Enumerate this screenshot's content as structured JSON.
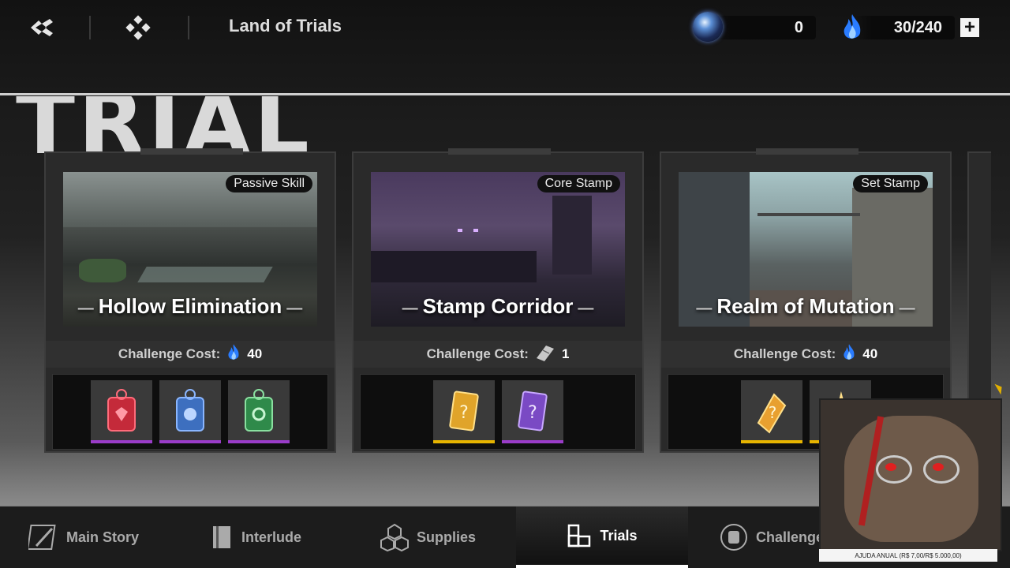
{
  "header": {
    "title": "Land of Trials",
    "orb_value": "0",
    "energy_value": "30/240",
    "add_label": "+"
  },
  "background_word": "TRIAL",
  "cards": [
    {
      "tag": "Passive Skill",
      "name": "Hollow Elimination",
      "cost_label": "Challenge Cost:",
      "cost_value": "40",
      "cost_icon": "blue-flame-icon"
    },
    {
      "tag": "Core Stamp",
      "name": "Stamp Corridor",
      "cost_label": "Challenge Cost:",
      "cost_value": "1",
      "cost_icon": "ticket-icon"
    },
    {
      "tag": "Set Stamp",
      "name": "Realm of Mutation",
      "cost_label": "Challenge Cost:",
      "cost_value": "40",
      "cost_icon": "blue-flame-icon"
    }
  ],
  "nav": {
    "main_story": "Main Story",
    "interlude": "Interlude",
    "supplies": "Supplies",
    "trials": "Trials",
    "challenge": "Challenge"
  },
  "overlay": {
    "banner": "AJUDA ANUAL (R$ 7,00/R$ 5.000,00)"
  },
  "colors": {
    "flame": "#2a7cff",
    "accent_purple": "#9a3cc9",
    "accent_gold": "#e6b400"
  }
}
